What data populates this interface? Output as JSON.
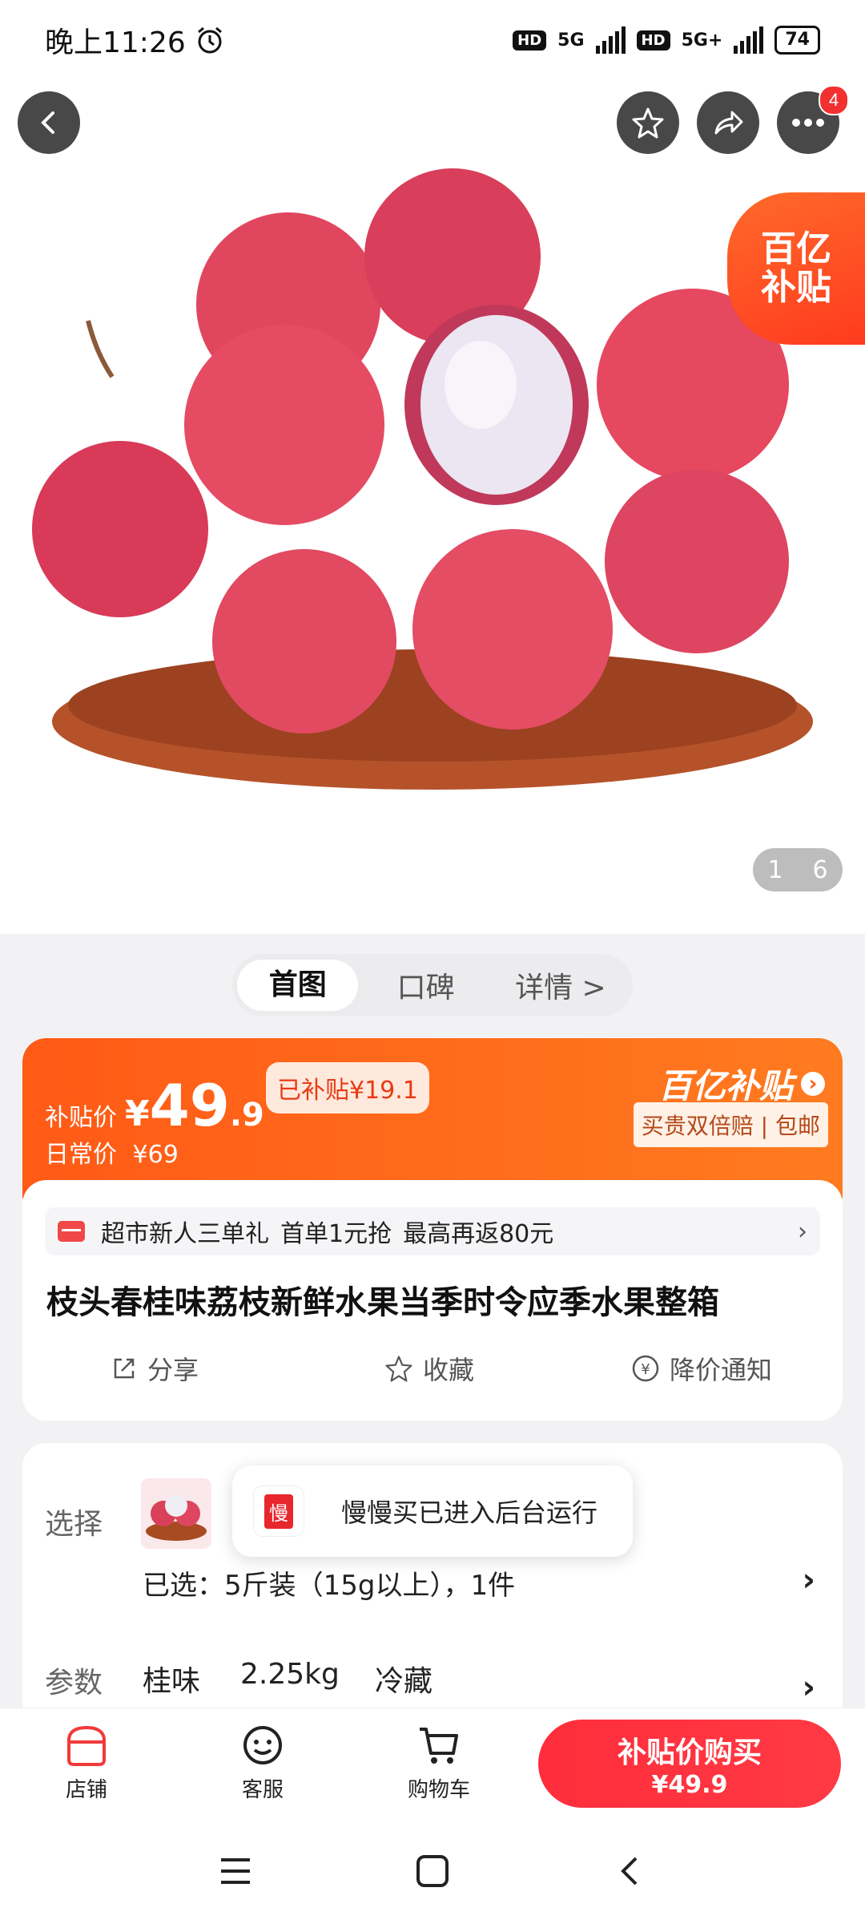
{
  "status_bar": {
    "time": "晚上11:26",
    "net1": "5G",
    "net2": "5G+",
    "hd": "HD",
    "battery": "74"
  },
  "top_nav": {
    "more_badge": "4"
  },
  "hero": {
    "subsidy_tag_line1": "百亿",
    "subsidy_tag_line2": "补贴",
    "pager_current": "1",
    "pager_total": "6"
  },
  "tabs": [
    {
      "label": "首图"
    },
    {
      "label": "口碑"
    },
    {
      "label": "详情 >"
    }
  ],
  "price": {
    "subsidy_label": "补贴价",
    "currency": "¥",
    "price_int": "49",
    "price_dec": ".9",
    "subsidized": "已补贴¥19.1",
    "daily_label": "日常价",
    "daily_price": "¥69",
    "brand": "百亿补贴",
    "guarantee": "买贵双倍赔 | 包邮"
  },
  "promo": {
    "text_a": "超市新人三单礼",
    "text_b": "首单1元抢",
    "text_c": "最高再返80元",
    "chevron": "›"
  },
  "product": {
    "title": "枝头春桂味荔枝新鲜水果当季时令应季水果整箱",
    "share": "分享",
    "favorite": "收藏",
    "price_alert": "降价通知"
  },
  "selection": {
    "label": "选择",
    "selected": "已选：5斤装（15g以上），1件",
    "params_label": "参数",
    "param1": "桂味",
    "param2": "2.25kg",
    "param3": "冷藏"
  },
  "toast": {
    "app_icon_text": "慢",
    "message": "慢慢买已进入后台运行"
  },
  "bottom_bar": {
    "store": "店铺",
    "service": "客服",
    "cart": "购物车",
    "buy_label": "补贴价购买",
    "buy_price": "¥49.9"
  },
  "colors": {
    "accent": "#ff5a16",
    "buy": "#ff2d3b",
    "brand_red": "#e8262d"
  },
  "icons": [
    "back-icon",
    "star-icon",
    "share-icon",
    "more-icon",
    "store-icon",
    "service-icon",
    "cart-icon",
    "menu-icon",
    "home-icon",
    "nav-back-icon"
  ]
}
